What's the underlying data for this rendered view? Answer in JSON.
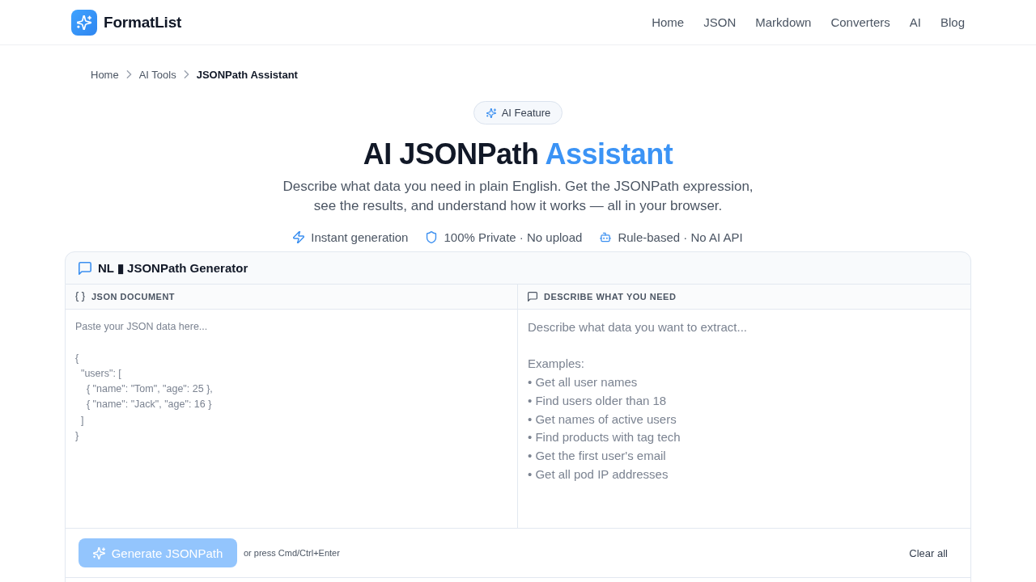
{
  "header": {
    "brand": "FormatList",
    "nav": [
      "Home",
      "JSON",
      "Markdown",
      "Converters",
      "AI",
      "Blog"
    ]
  },
  "breadcrumb": [
    {
      "label": "Home",
      "current": false
    },
    {
      "label": "AI Tools",
      "current": false
    },
    {
      "label": "JSONPath Assistant",
      "current": true
    }
  ],
  "badge": "AI Feature",
  "hero": {
    "title": "AI JSONPath",
    "title_highlight": "Assistant",
    "description": "Describe what data you need in plain English. Get the JSONPath expression, see the results, and understand how it works — all in your browser."
  },
  "features": [
    "Instant generation",
    "100% Private · No upload",
    "Rule-based · No AI API"
  ],
  "tool": {
    "title": "NL ▮ JSONPath Generator",
    "panels": [
      {
        "label": "JSON DOCUMENT",
        "placeholder": "Paste your JSON data here...\n\n{\n  \"users\": [\n    { \"name\": \"Tom\", \"age\": 25 },\n    { \"name\": \"Jack\", \"age\": 16 }\n  ]\n}"
      },
      {
        "label": "DESCRIBE WHAT YOU NEED",
        "placeholder": "Describe what data you want to extract...\n\nExamples:\n• Get all user names\n• Find users older than 18\n• Get names of active users\n• Find products with tag tech\n• Get the first user's email\n• Get all pod IP addresses"
      }
    ],
    "generate_button": {
      "label": "Generate JSONPath",
      "disabled": true
    },
    "shortcut_hint": "or press Cmd/Ctrl+Enter",
    "clear_button": "Clear all"
  }
}
